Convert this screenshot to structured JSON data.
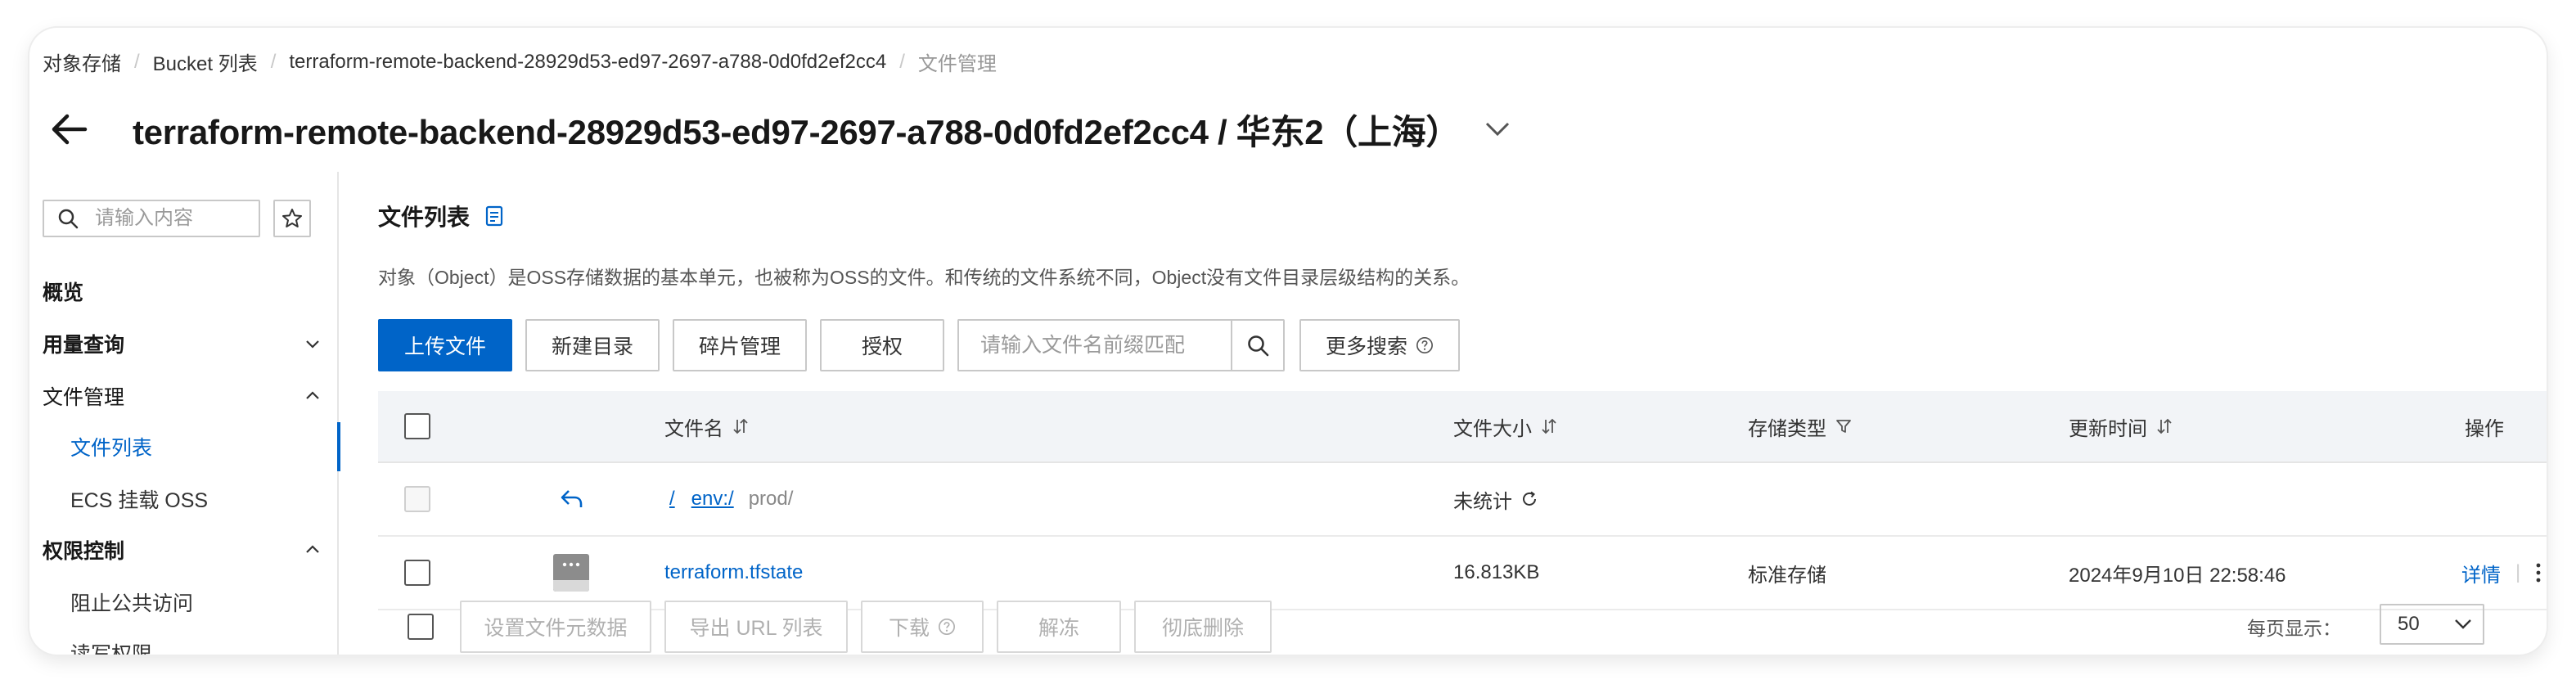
{
  "breadcrumb": {
    "items": [
      "对象存储",
      "Bucket 列表",
      "terraform-remote-backend-28929d53-ed97-2697-a788-0d0fd2ef2cc4"
    ],
    "current": "文件管理"
  },
  "header": {
    "title": "terraform-remote-backend-28929d53-ed97-2697-a788-0d0fd2ef2cc4 / 华东2（上海）"
  },
  "sidebar": {
    "search_placeholder": "请输入内容",
    "items": [
      {
        "label": "概览",
        "level": 1
      },
      {
        "label": "用量查询",
        "level": 1,
        "expanded": false
      },
      {
        "label": "文件管理",
        "level": 1,
        "expanded": true
      },
      {
        "label": "文件列表",
        "level": 2,
        "active": true
      },
      {
        "label": "ECS 挂载 OSS",
        "level": 2
      },
      {
        "label": "权限控制",
        "level": 1,
        "expanded": true
      },
      {
        "label": "阻止公共访问",
        "level": 2
      },
      {
        "label": "读写权限",
        "level": 2
      }
    ]
  },
  "main": {
    "section_title": "文件列表",
    "description": "对象（Object）是OSS存储数据的基本单元，也被称为OSS的文件。和传统的文件系统不同，Object没有文件目录层级结构的关系。",
    "toolbar": {
      "upload": "上传文件",
      "new_dir": "新建目录",
      "fragments": "碎片管理",
      "authorize": "授权",
      "search_placeholder": "请输入文件名前缀匹配",
      "more_search": "更多搜索"
    },
    "table": {
      "columns": {
        "name": "文件名",
        "size": "文件大小",
        "storage": "存储类型",
        "updated": "更新时间",
        "actions": "操作"
      },
      "path_row": {
        "root": "/",
        "segment": "env:/",
        "current": "prod/",
        "size": "未统计"
      },
      "rows": [
        {
          "name": "terraform.tfstate",
          "size": "16.813KB",
          "storage": "标准存储",
          "updated": "2024年9月10日 22:58:46",
          "action": "详情"
        }
      ]
    },
    "footer": {
      "set_meta": "设置文件元数据",
      "export_url": "导出 URL 列表",
      "download": "下载",
      "unfreeze": "解冻",
      "delete": "彻底删除",
      "page_size_label": "每页显示：",
      "page_size": "50"
    }
  },
  "colors": {
    "primary": "#0064c8",
    "header_bg": "#f2f4f7"
  }
}
